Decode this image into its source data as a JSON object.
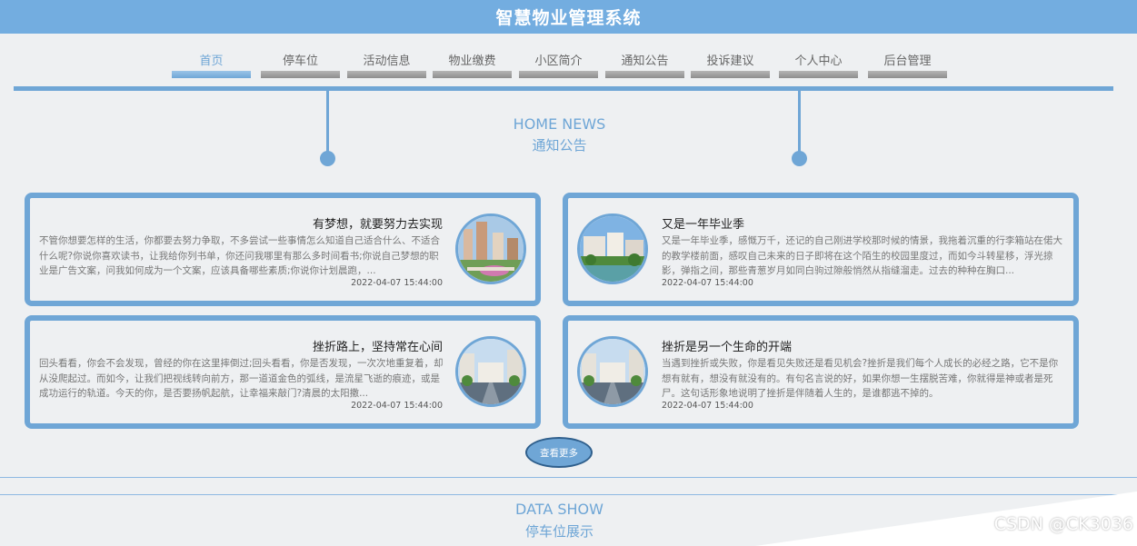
{
  "header": {
    "title": "智慧物业管理系统"
  },
  "nav": {
    "items": [
      {
        "label": "首页",
        "active": true
      },
      {
        "label": "停车位"
      },
      {
        "label": "活动信息"
      },
      {
        "label": "物业缴费"
      },
      {
        "label": "小区简介"
      },
      {
        "label": "通知公告"
      },
      {
        "label": "投诉建议"
      },
      {
        "label": "个人中心"
      },
      {
        "label": "后台管理"
      }
    ]
  },
  "news_section": {
    "title_en": "HOME NEWS",
    "title_cn": "通知公告"
  },
  "news": [
    {
      "title": "有梦想，就要努力去实现",
      "text": "不管你想要怎样的生活，你都要去努力争取，不多尝试一些事情怎么知道自己适合什么、不适合什么呢?你说你喜欢读书，让我给你列书单，你还问我哪里有那么多时间看书;你说自己梦想的职业是广告文案，问我如何成为一个文案，应该具备哪些素质;你说你计划晨跑，...",
      "date": "2022-04-07 15:44:00"
    },
    {
      "title": "又是一年毕业季",
      "text": "又是一年毕业季，感慨万千，还记的自己刚进学校那时候的情景，我拖着沉重的行李箱站在偌大的教学楼前面，感叹自己未来的日子即将在这个陌生的校园里度过，而如今斗转星移，浮光掠影，弹指之间，那些青葱岁月如同白驹过隙般悄然从指缝溜走。过去的种种在胸口...",
      "date": "2022-04-07 15:44:00"
    },
    {
      "title": "挫折路上，坚持常在心间",
      "text": "回头看看，你会不会发现，曾经的你在这里摔倒过;回头看看，你是否发现，一次次地重复着，却从没爬起过。而如今，让我们把视线转向前方，那一道道金色的弧线，是流星飞逝的痕迹，或是成功运行的轨道。今天的你，是否要扬帆起航，让幸福来敲门?清晨的太阳撒...",
      "date": "2022-04-07 15:44:00"
    },
    {
      "title": "挫折是另一个生命的开端",
      "text": "当遇到挫折或失败，你是看见失败还是看见机会?挫折是我们每个人成长的必经之路，它不是你想有就有，想没有就没有的。有句名言说的好，如果你想一生摆脱苦难，你就得是神或者是死尸。这句话形象地说明了挫折是伴随着人生的，是谁都逃不掉的。",
      "date": "2022-04-07 15:44:00"
    }
  ],
  "more_button": {
    "label": "查看更多"
  },
  "data_section": {
    "title_en": "DATA SHOW",
    "title_cn": "停车位展示"
  },
  "watermark": "CSDN @CK3036",
  "colors": {
    "primary": "#6fa6d6",
    "header": "#73ade0",
    "background": "#eef0f2"
  }
}
